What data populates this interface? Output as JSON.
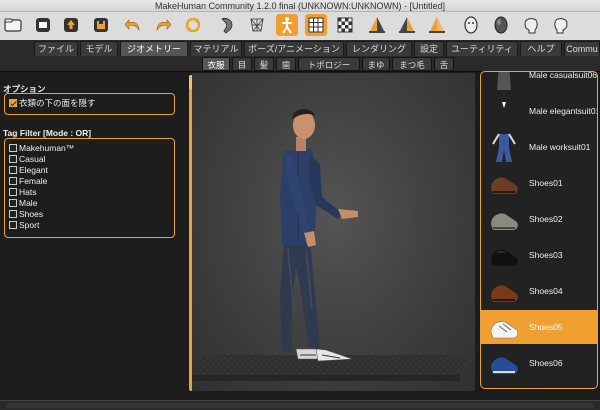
{
  "window": {
    "title": "MakeHuman Community 1.2.0 final (UNKNOWN:UNKNOWN) - [Untitled]"
  },
  "toolbar": {
    "buttons": [
      {
        "icon": "folder-icon"
      },
      {
        "icon": "new-file-icon"
      },
      {
        "icon": "load-icon"
      },
      {
        "icon": "save-icon"
      },
      {
        "icon": "undo-icon"
      },
      {
        "icon": "redo-icon"
      },
      {
        "icon": "reset-icon"
      },
      {
        "icon": "smooth-icon"
      },
      {
        "icon": "wireframe-icon"
      },
      {
        "icon": "pose-icon"
      },
      {
        "icon": "grid-icon"
      },
      {
        "icon": "checker-icon"
      },
      {
        "icon": "front-view-icon"
      },
      {
        "icon": "side-view-icon"
      },
      {
        "icon": "back-view-icon"
      },
      {
        "icon": "face-mask-icon"
      },
      {
        "icon": "egg-icon"
      },
      {
        "icon": "head-left-icon"
      },
      {
        "icon": "head-right-icon"
      }
    ]
  },
  "main_tabs": [
    "ファイル",
    "モデル",
    "ジオメトリー",
    "マテリアル",
    "ポーズ/アニメーション",
    "レンダリング",
    "設定",
    "ユーティリティ",
    "ヘルプ",
    "Commu"
  ],
  "main_tab_active": "ジオメトリー",
  "sub_tabs": [
    "衣服",
    "目",
    "髪",
    "歯",
    "トポロジー",
    "まゆ",
    "まつ毛",
    "舌"
  ],
  "sub_tab_active": "衣服",
  "options": {
    "title": "オプション",
    "hide_faces": {
      "label": "衣類の下の面を隠す",
      "checked": true
    }
  },
  "tag_filter": {
    "title": "Tag Filter [Mode : OR]",
    "tags": [
      {
        "label": "Makehuman™",
        "checked": false
      },
      {
        "label": "Casual",
        "checked": false
      },
      {
        "label": "Elegant",
        "checked": false
      },
      {
        "label": "Female",
        "checked": false
      },
      {
        "label": "Hats",
        "checked": false
      },
      {
        "label": "Male",
        "checked": false
      },
      {
        "label": "Shoes",
        "checked": false
      },
      {
        "label": "Sport",
        "checked": false
      }
    ]
  },
  "clothes_list": {
    "items": [
      {
        "label": "Male casualsuit06",
        "thumb": "suit-thumb",
        "selected": false
      },
      {
        "label": "Male elegantsuit01",
        "thumb": "suit-thumb",
        "selected": false
      },
      {
        "label": "Male worksuit01",
        "thumb": "worksuit-thumb",
        "selected": false
      },
      {
        "label": "Shoes01",
        "thumb": "shoe-brown-thumb",
        "selected": false
      },
      {
        "label": "Shoes02",
        "thumb": "shoe-grey-thumb",
        "selected": false
      },
      {
        "label": "Shoes03",
        "thumb": "shoe-black-thumb",
        "selected": false
      },
      {
        "label": "Shoes04",
        "thumb": "shoe-brown-thumb",
        "selected": false
      },
      {
        "label": "Shoes05",
        "thumb": "shoe-white-thumb",
        "selected": true
      },
      {
        "label": "Shoes06",
        "thumb": "shoe-blue-thumb",
        "selected": false
      }
    ]
  },
  "colors": {
    "accent": "#e8a33a",
    "selected": "#f0a030",
    "panel_bg": "#1d1d1d"
  }
}
